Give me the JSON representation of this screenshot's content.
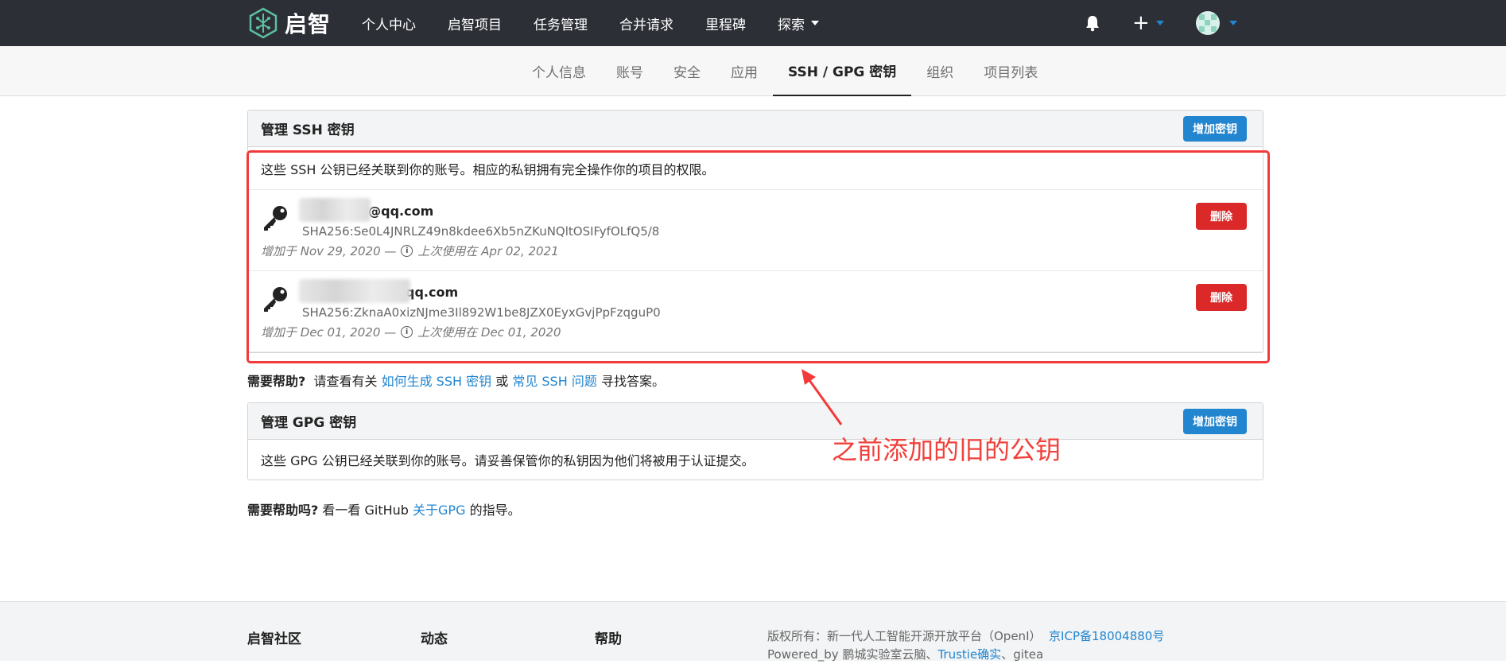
{
  "brand": {
    "name": "启智"
  },
  "nav": {
    "items": [
      "个人中心",
      "启智项目",
      "任务管理",
      "合并请求",
      "里程碑"
    ],
    "explore": "探索",
    "plus": "+"
  },
  "tabs": [
    "个人信息",
    "账号",
    "安全",
    "应用",
    "SSH / GPG 密钥",
    "组织",
    "项目列表"
  ],
  "ssh": {
    "title": "管理 SSH 密钥",
    "add_label": "增加密钥",
    "desc": "这些 SSH 公钥已经关联到你的账号。相应的私钥拥有完全操作你的项目的权限。",
    "keys": [
      {
        "name": "2@qq.com",
        "fingerprint": "SHA256:Se0L4JNRLZ49n8kdee6Xb5nZKuNQltOSIFyfOLfQ5/8",
        "added": "增加于 Nov 29, 2020 —",
        "last_used": "上次使用在 Apr 02, 2021",
        "delete_label": "删除"
      },
      {
        "name": "qq.com",
        "fingerprint": "SHA256:ZknaA0xizNJme3Il892W1be8JZX0EyxGvjPpFzqguP0",
        "added": "增加于 Dec 01, 2020 —",
        "last_used": "上次使用在 Dec 01, 2020",
        "delete_label": "删除"
      }
    ]
  },
  "ssh_help": {
    "bold": "需要帮助?",
    "text1": "请查看有关",
    "link1": "如何生成 SSH 密钥",
    "text2": "或",
    "link2": "常见 SSH 问题",
    "text3": "寻找答案。"
  },
  "gpg": {
    "title": "管理 GPG 密钥",
    "add_label": "增加密钥",
    "desc": "这些 GPG 公钥已经关联到你的账号。请妥善保管你的私钥因为他们将被用于认证提交。"
  },
  "gpg_help": {
    "bold": "需要帮助吗?",
    "text1": "看一看 GitHub",
    "link": "关于GPG",
    "text2": "的指导。"
  },
  "annotation": "之前添加的旧的公钥",
  "footer": {
    "col1": "启智社区",
    "col2": "动态",
    "col3": "帮助",
    "copyright": "版权所有：新一代人工智能开源开放平台（OpenI）",
    "icp": "京ICP备18004880号",
    "powered_prefix": "Powered_by 鹏城实验室云脑、",
    "trustie": "Trustie确实",
    "powered_suffix": "、gitea"
  },
  "colors": {
    "navbar": "#2c2f36",
    "primary": "#2185d0",
    "danger": "#db2828",
    "annotation": "#f23a3a"
  }
}
